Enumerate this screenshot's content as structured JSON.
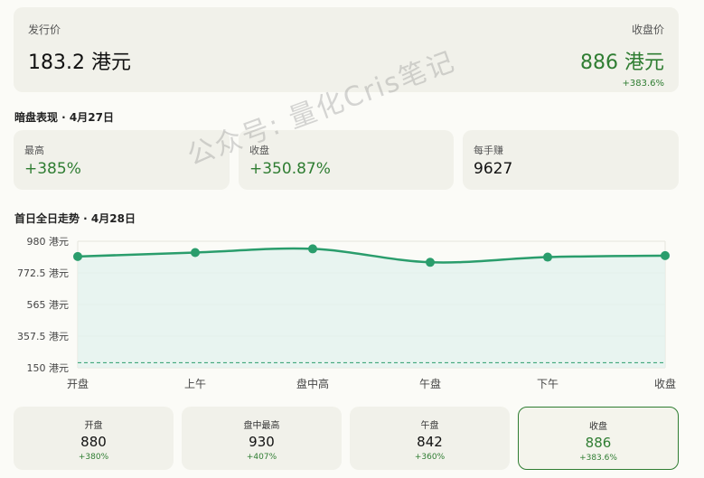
{
  "header": {
    "issue_label": "发行价",
    "issue_value": "183.2 港元",
    "close_label": "收盘价",
    "close_value": "886 港元",
    "close_change": "+383.6%"
  },
  "dark": {
    "section_title": "暗盘表现 · 4月27日",
    "cards": [
      {
        "label": "最高",
        "value": "+385%"
      },
      {
        "label": "收盘",
        "value": "+350.87%"
      },
      {
        "label": "每手赚",
        "value": "9627"
      }
    ]
  },
  "day": {
    "section_title": "首日全日走势 · 4月28日"
  },
  "chart_data": {
    "type": "line",
    "title": "首日全日走势 · 4月28日",
    "categories": [
      "开盘",
      "上午",
      "盘中高",
      "午盘",
      "下午",
      "收盘"
    ],
    "series": [
      {
        "values": [
          880,
          906,
          930,
          842,
          876,
          886
        ]
      }
    ],
    "reference_line": 183.2,
    "ylim": [
      150,
      980
    ],
    "yticks": [
      "980 港元",
      "772.5 港元",
      "565 港元",
      "357.5 港元",
      "150 港元"
    ],
    "ytick_values": [
      980,
      772.5,
      565,
      357.5,
      150
    ],
    "line_color": "#2a9d6c",
    "fill_color": "#e3f3ee",
    "grid": true
  },
  "bottom_cards": [
    {
      "label": "开盘",
      "value": "880",
      "change": "+380%"
    },
    {
      "label": "盘中最高",
      "value": "930",
      "change": "+407%"
    },
    {
      "label": "午盘",
      "value": "842",
      "change": "+360%"
    },
    {
      "label": "收盘",
      "value": "886",
      "change": "+383.6%"
    }
  ],
  "watermark": "公众号: 量化Cris笔记",
  "colors": {
    "accent": "#2f7d32",
    "card_bg": "#f1f1ea"
  }
}
